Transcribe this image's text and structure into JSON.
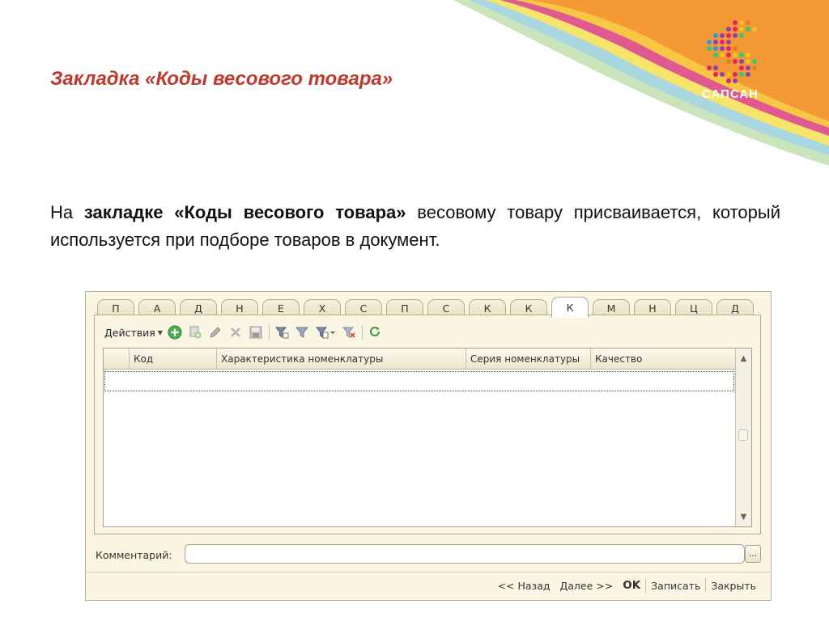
{
  "slide": {
    "title": "Закладка «Коды весового товара»",
    "body_intro": "На ",
    "body_bold": "закладке «Коды весового товара»",
    "body_rest": " весовому товару присваивается, который используется при подборе товаров в документ."
  },
  "logo": {
    "text": "САПСАН",
    "dot_colors": [
      "#8e44ad",
      "#e91e63",
      "#2ecc71",
      "#f1c40f",
      "#3498db",
      "#e67e22"
    ]
  },
  "colors": {
    "title": "#c0392b",
    "orange": "#f39a36",
    "window_bg": "#fbf6e4"
  },
  "window": {
    "tabs": [
      "П",
      "А",
      "Д",
      "Н",
      "Е",
      "Х",
      "С",
      "П",
      "С",
      "К",
      "К",
      "К",
      "М",
      "Н",
      "Ц",
      "Д"
    ],
    "active_tab_index": 11,
    "toolbar": {
      "actions_label": "Действия",
      "icons": [
        "add-icon",
        "copy-icon",
        "edit-icon",
        "delete-icon",
        "save-icon",
        "filter-set-icon",
        "filter-icon",
        "filter-list-icon",
        "filter-clear-icon",
        "refresh-icon"
      ]
    },
    "table": {
      "columns": [
        "",
        "Код",
        "Характеристика номенклатуры",
        "Серия номенклатуры",
        "Качество"
      ]
    },
    "comment": {
      "label": "Комментарий:",
      "value": "",
      "button_label": "..."
    },
    "bottom": {
      "back": "<< Назад",
      "next": "Далее >>",
      "ok": "OK",
      "save": "Записать",
      "close": "Закрыть"
    }
  }
}
